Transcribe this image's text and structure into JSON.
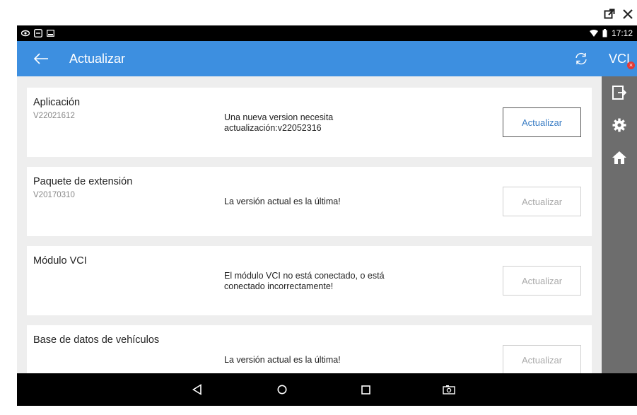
{
  "status_bar": {
    "time": "17:12",
    "left_icons": [
      "eye-icon",
      "sync-notification-icon",
      "image-icon"
    ],
    "right_icons": [
      "wifi-icon",
      "battery-icon"
    ]
  },
  "window_controls": [
    "restore-icon",
    "close-icon"
  ],
  "app_bar": {
    "title": "Actualizar",
    "back_icon": "arrow-left-icon",
    "sync_icon": "sync-icon",
    "color": "#3d8fe0"
  },
  "sidebar": {
    "vci_label": "VCI",
    "vci_badge": "×",
    "items": [
      "exit-icon",
      "gear-icon",
      "home-icon"
    ]
  },
  "cards": [
    {
      "title": "Aplicación",
      "version": "V22021612",
      "status_lines": [
        "Una nueva version necesita",
        "actualización:v22052316"
      ],
      "button": "Actualizar",
      "button_enabled": true
    },
    {
      "title": "Paquete de extensión",
      "version": "V20170310",
      "status_lines": [
        "La versión actual es la última!"
      ],
      "button": "Actualizar",
      "button_enabled": false
    },
    {
      "title": "Módulo VCI",
      "version": "",
      "status_lines": [
        "El módulo VCI no está conectado, o está",
        "conectado incorrectamente!"
      ],
      "button": "Actualizar",
      "button_enabled": false
    },
    {
      "title": "Base de datos de vehículos",
      "version": "",
      "status_lines": [
        "La versión actual es la última!"
      ],
      "button": "Actualizar",
      "button_enabled": false
    }
  ],
  "nav_bar": {
    "buttons": [
      "back-triangle-icon",
      "home-circle-icon",
      "recents-square-icon",
      "screenshot-camera-icon"
    ]
  }
}
